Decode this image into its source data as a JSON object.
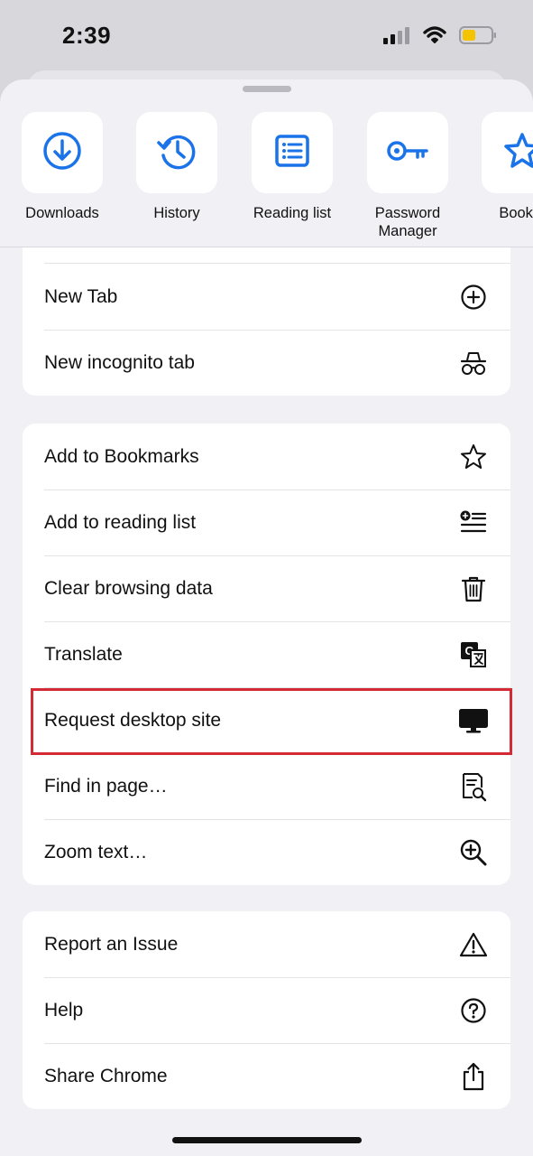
{
  "status": {
    "time": "2:39",
    "icons": [
      "signal-icon",
      "wifi-icon",
      "battery-icon"
    ]
  },
  "shortcuts": [
    {
      "label": "Downloads",
      "icon": "download-icon"
    },
    {
      "label": "History",
      "icon": "history-icon"
    },
    {
      "label": "Reading list",
      "icon": "reading-list-icon"
    },
    {
      "label": "Password Manager",
      "icon": "key-icon"
    },
    {
      "label": "Bookm",
      "icon": "star-icon"
    }
  ],
  "menu": {
    "tabs": [
      {
        "label": "New Tab",
        "icon": "plus-circle-icon"
      },
      {
        "label": "New incognito tab",
        "icon": "incognito-icon"
      }
    ],
    "page": [
      {
        "label": "Add to Bookmarks",
        "icon": "star-outline-icon"
      },
      {
        "label": "Add to reading list",
        "icon": "add-list-icon"
      },
      {
        "label": "Clear browsing data",
        "icon": "trash-icon"
      },
      {
        "label": "Translate",
        "icon": "translate-icon"
      },
      {
        "label": "Request desktop site",
        "icon": "desktop-icon"
      },
      {
        "label": "Find in page…",
        "icon": "find-in-page-icon"
      },
      {
        "label": "Zoom text…",
        "icon": "zoom-in-icon"
      }
    ],
    "other": [
      {
        "label": "Report an Issue",
        "icon": "warning-icon"
      },
      {
        "label": "Help",
        "icon": "help-icon"
      },
      {
        "label": "Share Chrome",
        "icon": "share-icon"
      }
    ]
  },
  "colors": {
    "accent": "#1a73e8",
    "highlight": "#d42a35",
    "battery": "#f5c400"
  }
}
